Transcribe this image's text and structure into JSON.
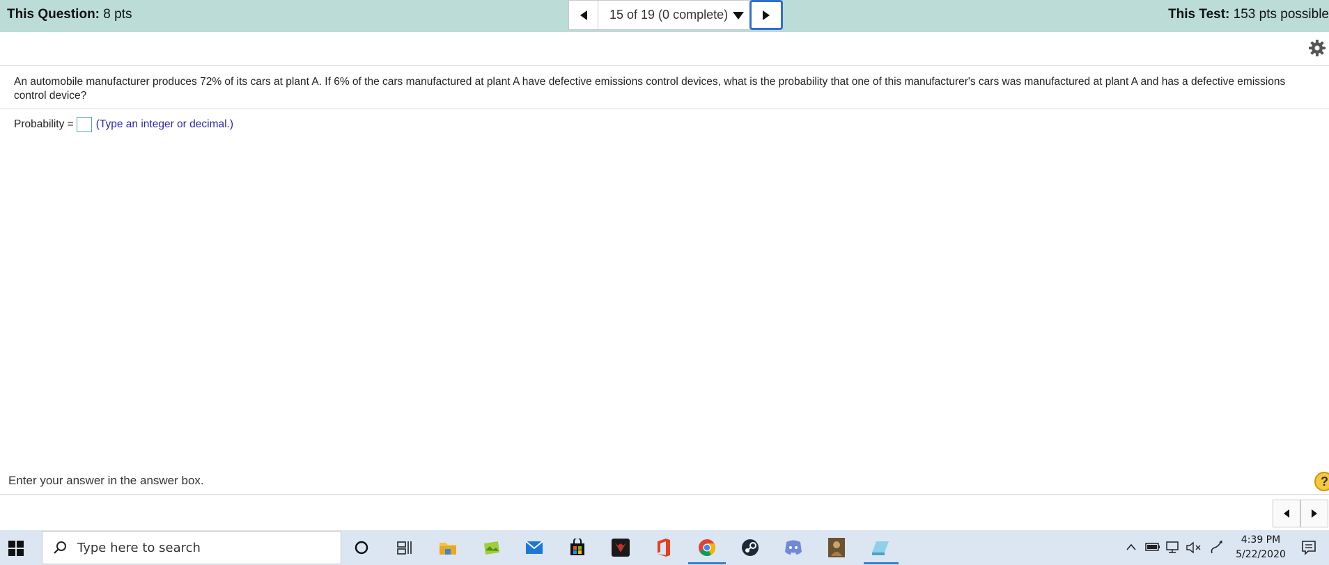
{
  "header": {
    "question_label": "This Question:",
    "question_points": "8 pts",
    "test_label": "This Test:",
    "test_points": "153 pts possible",
    "nav_status": "15 of 19 (0 complete)"
  },
  "question": {
    "text": "An automobile manufacturer produces 72% of its cars at plant A. If 6% of the cars manufactured at plant A have defective emissions control devices, what is the probability that one of this manufacturer's cars was manufactured at plant A and has a defective emissions control device?",
    "answer_label": "Probability =",
    "answer_value": "",
    "answer_hint": "(Type an integer or decimal.)"
  },
  "footer": {
    "instructions": "Enter your answer in the answer box.",
    "help_symbol": "?"
  },
  "taskbar": {
    "search_placeholder": "Type here to search",
    "clock_time": "4:39 PM",
    "clock_date": "5/22/2020",
    "icons": [
      "cortana-icon",
      "task-view-icon",
      "file-explorer-icon",
      "photos-icon",
      "mail-icon",
      "store-icon",
      "predator-icon",
      "office-icon",
      "chrome-icon",
      "steam-icon",
      "discord-icon",
      "game-icon",
      "notepad-icon"
    ]
  },
  "colors": {
    "header_bg": "#bcdcd8",
    "hint_blue": "#2a2aa8",
    "answer_box_border": "#5aa7b6",
    "focus_blue": "#2e6fcf",
    "taskbar_bg": "#dbe6f2"
  }
}
